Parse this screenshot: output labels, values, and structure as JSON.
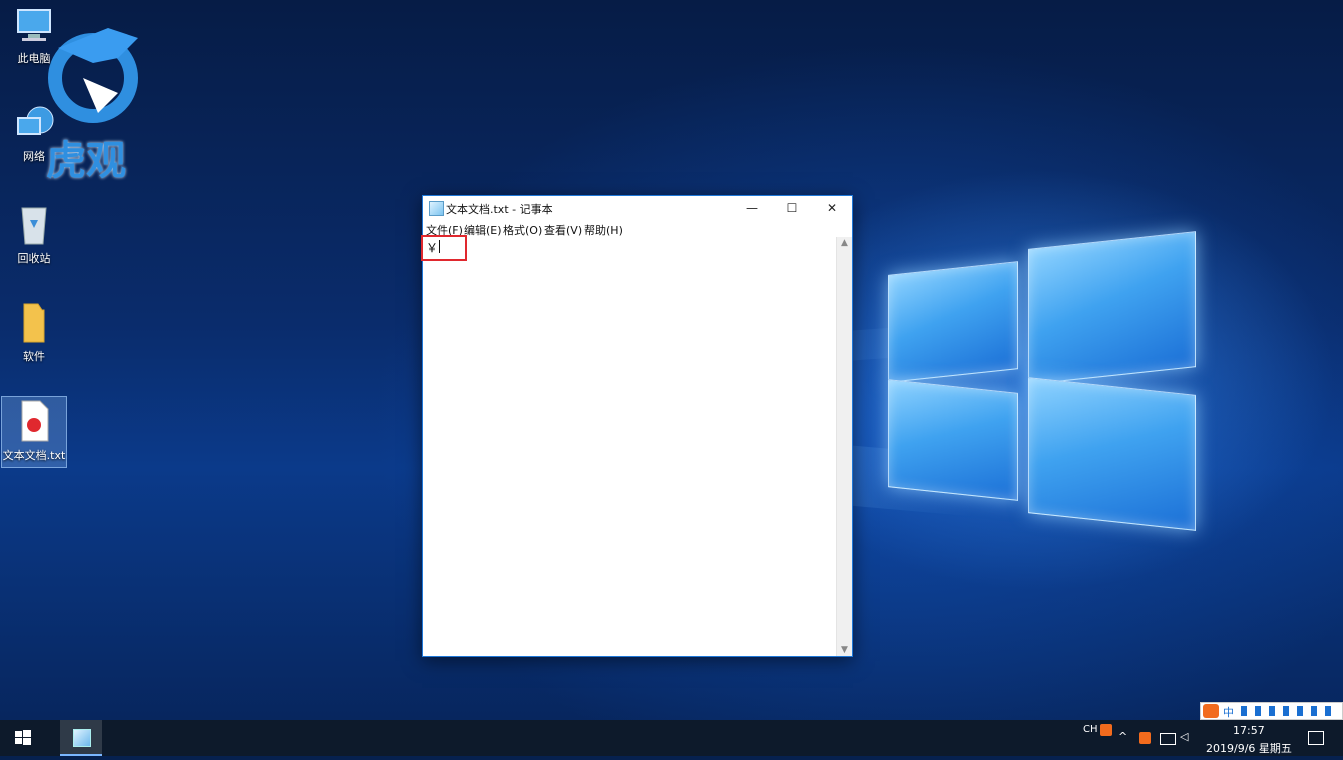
{
  "desktop": {
    "icons": [
      {
        "label": "此电脑",
        "name": "this-pc"
      },
      {
        "label": "网络",
        "name": "network"
      },
      {
        "label": "回收站",
        "name": "recycle-bin"
      },
      {
        "label": "软件",
        "name": "software-folder"
      },
      {
        "label": "文本文档.txt",
        "name": "text-document"
      }
    ],
    "watermark_text": "虎观"
  },
  "notepad": {
    "title": "文本文档.txt - 记事本",
    "minimize_glyph": "—",
    "maximize_glyph": "☐",
    "close_glyph": "✕",
    "menu": [
      "文件(F)",
      "编辑(E)",
      "格式(O)",
      "查看(V)",
      "帮助(H)"
    ],
    "content": "￥"
  },
  "taskbar": {
    "lang": "CH",
    "time": "17:57",
    "date": "2019/9/6 星期五",
    "ime_label": "中"
  },
  "colors": {
    "highlight": "#e0282e",
    "accent": "#1f78d8"
  }
}
